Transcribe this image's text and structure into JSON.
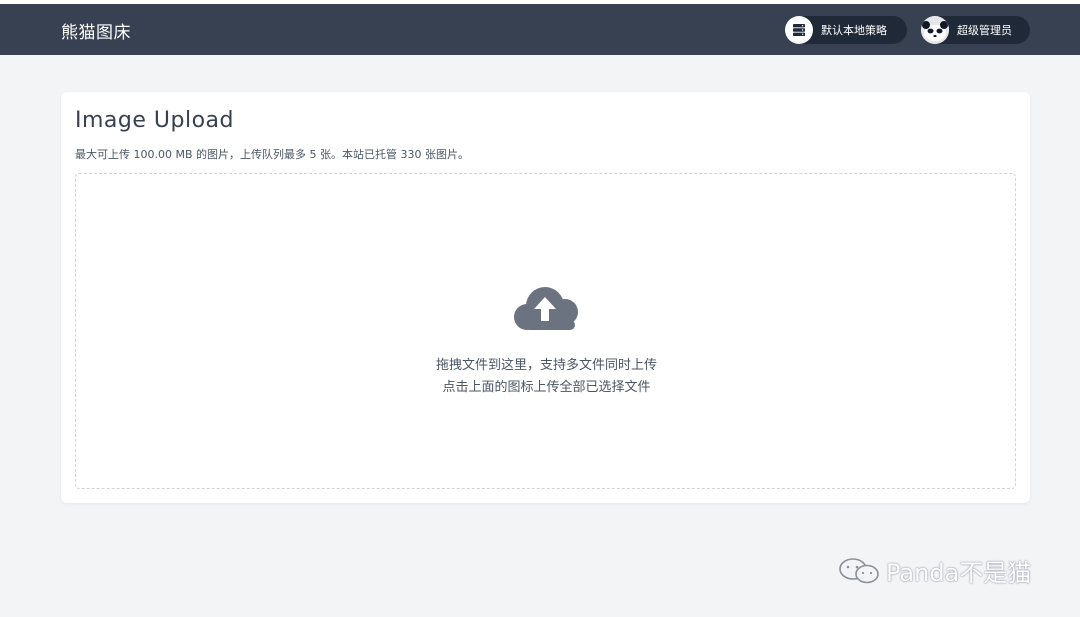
{
  "navbar": {
    "brand": "熊猫图床",
    "strategy_label": "默认本地策略",
    "strategy_icon": "server-icon",
    "user_label": "超级管理员",
    "user_icon": "panda-avatar"
  },
  "upload": {
    "title": "Image Upload",
    "subtitle": "最大可上传 100.00 MB 的图片，上传队列最多 5 张。本站已托管 330 张图片。",
    "icon": "cloud-upload-icon",
    "hint_line1": "拖拽文件到这里，支持多文件同时上传",
    "hint_line2": "点击上面的图标上传全部已选择文件"
  },
  "watermark": {
    "text": "Panda不是猫",
    "icon": "wechat-icon"
  },
  "colors": {
    "navbar_bg": "#374151",
    "page_bg": "#f3f4f6",
    "icon_gray": "#6b7280"
  }
}
